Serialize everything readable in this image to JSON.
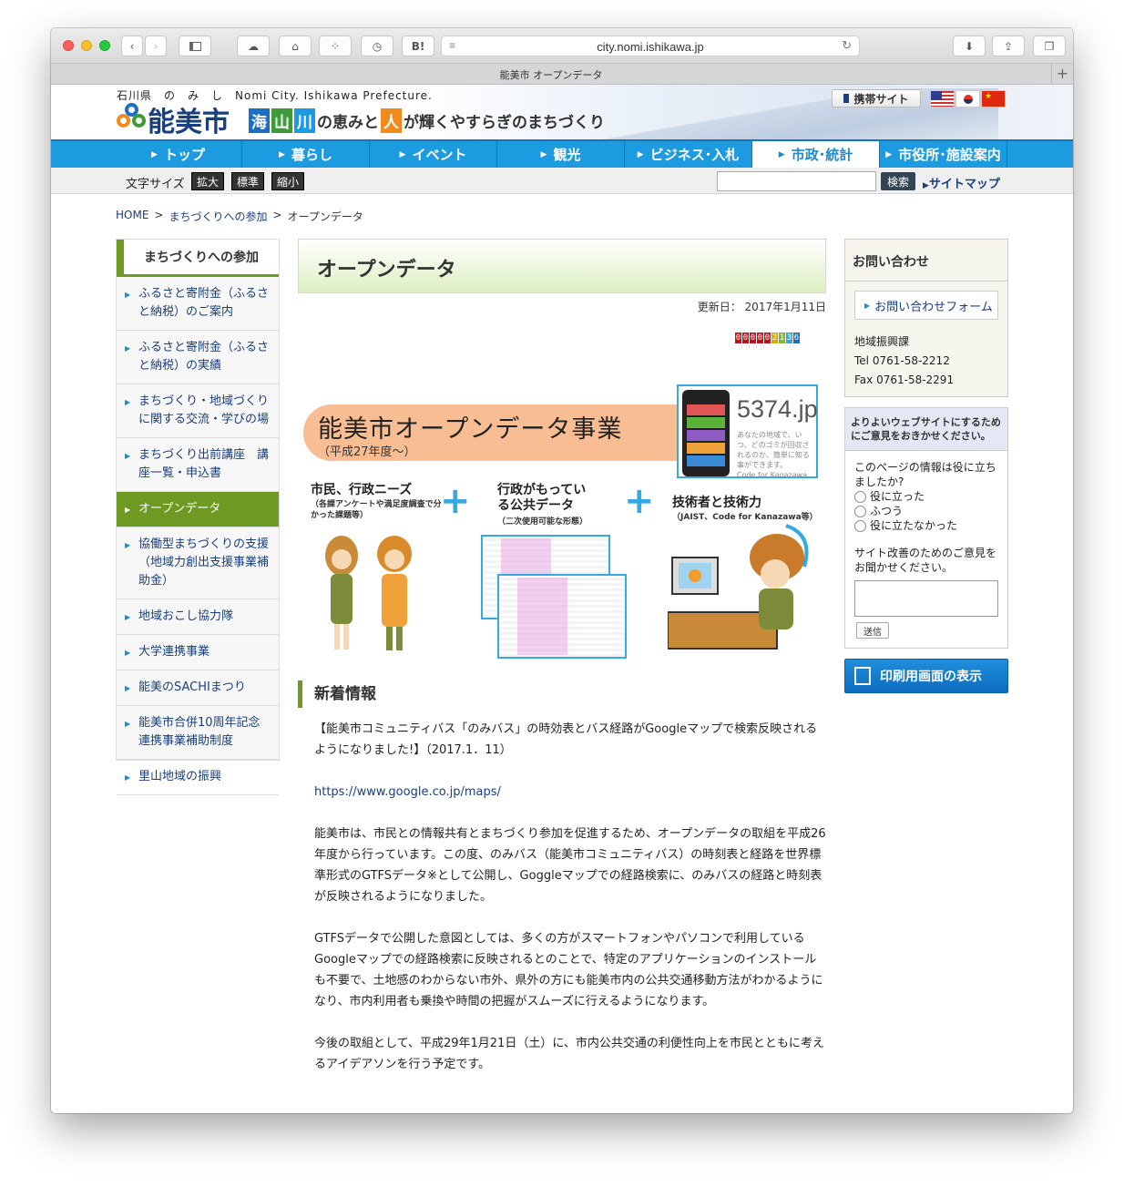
{
  "browser": {
    "url": "city.nomi.ishikawa.jp",
    "tab_title": "能美市 オープンデータ",
    "hatena_label": "B!",
    "new_tab": "+"
  },
  "header": {
    "prefecture_reading": "石川県　の　み　し　Nomi City. Ishikawa Prefecture.",
    "city_name": "能美市",
    "tagline_kanji": [
      "海",
      "山",
      "川"
    ],
    "tagline_part1": "の恵みと",
    "tagline_person": "人",
    "tagline_part2": "が輝くやすらぎのまちづくり",
    "mobile_site": "携帯サイト",
    "colors": {
      "sea": "#1d6fc4",
      "mountain": "#3f9a3a",
      "river": "#1d9be0",
      "person": "#f08a1c"
    }
  },
  "global_nav": [
    "トップ",
    "暮らし",
    "イベント",
    "観光",
    "ビジネス･入札",
    "市政･統計",
    "市役所･施設案内"
  ],
  "utility": {
    "font_size_label": "文字サイズ",
    "font_buttons": [
      "拡大",
      "標準",
      "縮小"
    ],
    "search_placeholder": "",
    "search_button": "検索",
    "sitemap": "サイトマップ"
  },
  "breadcrumb": [
    "HOME",
    ">",
    "まちづくりへの参加",
    ">",
    "オープンデータ"
  ],
  "left_nav": {
    "heading": "まちづくりへの参加",
    "items": [
      "ふるさと寄附金（ふるさと納税）のご案内",
      "ふるさと寄附金（ふるさと納税）の実績",
      "まちづくり・地域づくりに関する交流・学びの場",
      "まちづくり出前講座　講座一覧・申込書",
      "オープンデータ",
      "協働型まちづくりの支援（地域力創出支援事業補助金）",
      "地域おこし協力隊",
      "大学連携事業",
      "能美のSACHIまつり",
      "能美市合併10周年記念連携事業補助制度",
      "里山地域の振興"
    ]
  },
  "main": {
    "title": "オープンデータ",
    "updated": "更新日： 2017年1月11日",
    "counter_digits": [
      "0",
      "0",
      "0",
      "0",
      "0",
      "2",
      "1",
      "3",
      "6"
    ],
    "banner": {
      "title": "能美市オープンデータ事業",
      "subtitle": "（平成27年度～）",
      "app_name": "5374.jp",
      "app_text": "あなたの地域で、いつ、どのゴミが回収されるのか、簡単に知る事ができます。",
      "app_footer": "Code for Kanazawa",
      "col1_heading": "市民、行政ニーズ",
      "col1_sub": "（各課アンケートや満足度調査で分かった課題等）",
      "col2_heading": "行政がもっている公共データ",
      "col2_sub": "（二次使用可能な形態）",
      "col3_heading": "技術者と技術力",
      "col3_sub": "（JAIST、Code for Kanazawa等）"
    },
    "news_heading": "新着情報",
    "paragraphs": [
      "【能美市コミュニティバス「のみバス」の時効表とバス経路がGoogleマップで検索反映されるようになりました!】（2017.1．11）",
      "https://www.google.co.jp/maps/",
      "能美市は、市民との情報共有とまちづくり参加を促進するため、オープンデータの取組を平成26年度から行っています。この度、のみバス（能美市コミュニティバス）の時刻表と経路を世界標準形式のGTFSデータ※として公開し、Goggleマップでの経路検索に、のみバスの経路と時刻表が反映されるようになりました。",
      "GTFSデータで公開した意図としては、多くの方がスマートフォンやパソコンで利用しているGoogleマップでの経路検索に反映されるとのことで、特定のアプリケーションのインストールも不要で、土地感のわからない市外、県外の方にも能美市内の公共交通移動方法がわかるようになり、市内利用者も乗換や時間の把握がスムーズに行えるようになります。",
      "今後の取組として、平成29年1月21日（土）に、市内公共交通の利便性向上を市民とともに考えるアイデアソンを行う予定です。"
    ]
  },
  "right": {
    "contact_heading": "お問い合わせ",
    "contact_form": "お問い合わせフォーム",
    "department": "地域振興課",
    "tel": "Tel 0761-58-2212",
    "fax": "Fax 0761-58-2291",
    "feedback_heading": "よりよいウェブサイトにするためにご意見をおきかせください。",
    "question": "このページの情報は役に立ちましたか?",
    "options": [
      "役に立った",
      "ふつう",
      "役に立たなかった"
    ],
    "opinion_label": "サイト改善のためのご意見をお聞かせください。",
    "send": "送信",
    "print": "印刷用画面の表示"
  }
}
